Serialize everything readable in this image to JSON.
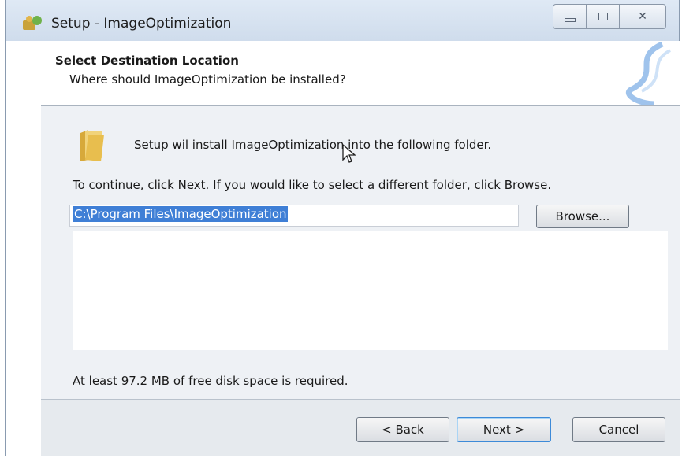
{
  "window": {
    "title": "Setup - ImageOptimization",
    "buttons": {
      "minimize": "minimize",
      "maximize": "maximize",
      "close": "✕"
    }
  },
  "header": {
    "title": "Select Destination Location",
    "subtitle": "Where should ImageOptimization be installed?"
  },
  "body": {
    "intro": "Setup wil install ImageOptimization into the following folder.",
    "instructions": "To continue, click Next. If you would like to select a different folder, click Browse.",
    "path_value": "C:\\Program Files\\ImageOptimization",
    "browse_label": "Browse...",
    "disk_space": "At least 97.2 MB of free disk space is required."
  },
  "footer": {
    "back_label": "< Back",
    "next_label": "Next >",
    "cancel_label": "Cancel"
  },
  "colors": {
    "selection": "#3f7fd6",
    "title_bar": "#dfe9f5",
    "panel": "#eef1f5"
  },
  "icons": [
    "setup-app-icon",
    "folder-icon",
    "mouse-cursor-icon",
    "header-swirl-art"
  ]
}
